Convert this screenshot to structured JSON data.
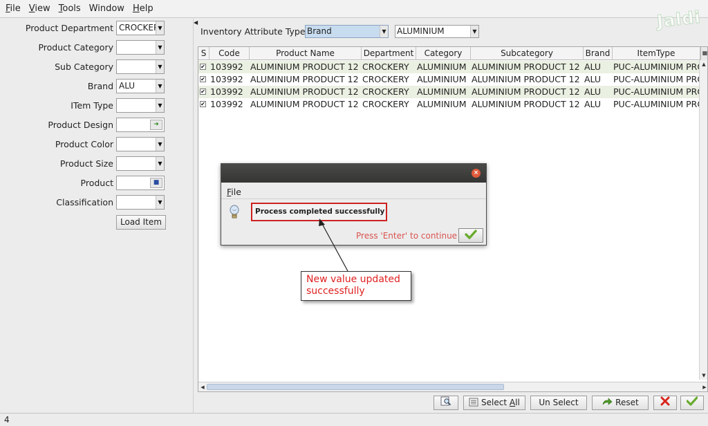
{
  "menu": {
    "items": [
      {
        "label": "File",
        "first": "F",
        "rest": "ile"
      },
      {
        "label": "View",
        "first": "V",
        "rest": "iew"
      },
      {
        "label": "Tools",
        "first": "T",
        "rest": "ools"
      },
      {
        "label": "Window",
        "first": "",
        "rest": "Window"
      },
      {
        "label": "Help",
        "first": "H",
        "rest": "elp"
      }
    ]
  },
  "logo": "Jaldi",
  "filters": [
    {
      "label": "Product Department",
      "value": "CROCKERY",
      "kind": "combo"
    },
    {
      "label": "Product Category",
      "value": "",
      "kind": "combo"
    },
    {
      "label": "Sub Category",
      "value": "",
      "kind": "combo"
    },
    {
      "label": "Brand",
      "value": "ALU",
      "kind": "combo"
    },
    {
      "label": "ITem Type",
      "value": "",
      "kind": "combo"
    },
    {
      "label": "Product Design",
      "value": "",
      "kind": "lookup"
    },
    {
      "label": "Product Color",
      "value": "",
      "kind": "combo"
    },
    {
      "label": "Product Size",
      "value": "",
      "kind": "combo"
    },
    {
      "label": "Product",
      "value": "",
      "kind": "lookup"
    },
    {
      "label": "Classification",
      "value": "",
      "kind": "combo"
    }
  ],
  "load_item_label": "Load Item",
  "attribute": {
    "label": "Inventory Attribute Type",
    "type_value": "Brand",
    "value": "ALUMINIUM"
  },
  "table": {
    "columns": [
      "S",
      "Code",
      "Product Name",
      "Department",
      "Category",
      "Subcategory",
      "Brand",
      "ItemType"
    ],
    "rows": [
      {
        "checked": true,
        "code": "103992",
        "name": "ALUMINIUM PRODUCT 12",
        "department": "CROCKERY",
        "category": "ALUMINIUM",
        "subcategory": "ALUMINIUM PRODUCT 12",
        "brand": "ALU",
        "itemtype": "PUC-ALUMINIUM PRO"
      },
      {
        "checked": true,
        "code": "103992",
        "name": "ALUMINIUM PRODUCT 12",
        "department": "CROCKERY",
        "category": "ALUMINIUM",
        "subcategory": "ALUMINIUM PRODUCT 12",
        "brand": "ALU",
        "itemtype": "PUC-ALUMINIUM PRO"
      },
      {
        "checked": true,
        "code": "103992",
        "name": "ALUMINIUM PRODUCT 12",
        "department": "CROCKERY",
        "category": "ALUMINIUM",
        "subcategory": "ALUMINIUM PRODUCT 12",
        "brand": "ALU",
        "itemtype": "PUC-ALUMINIUM PRO"
      },
      {
        "checked": true,
        "code": "103992",
        "name": "ALUMINIUM PRODUCT 12",
        "department": "CROCKERY",
        "category": "ALUMINIUM",
        "subcategory": "ALUMINIUM PRODUCT 12",
        "brand": "ALU",
        "itemtype": "PUC-ALUMINIUM PRO"
      }
    ]
  },
  "bottom_buttons": {
    "select_all_prefix": "Select ",
    "select_all_ul": "A",
    "select_all_suffix": "ll",
    "unselect": "Un Select",
    "reset": "Reset"
  },
  "status": "4",
  "dialog": {
    "menu_first": "F",
    "menu_rest": "ile",
    "message": "Process completed successfully",
    "enter_hint": "Press 'Enter' to continue"
  },
  "callout": "New value updated successfully",
  "colors": {
    "accent_red": "#cc2222",
    "row_alt": "#eaf0e2",
    "selected_combo": "#c8dcf0",
    "ok_green": "#6aab2e"
  }
}
